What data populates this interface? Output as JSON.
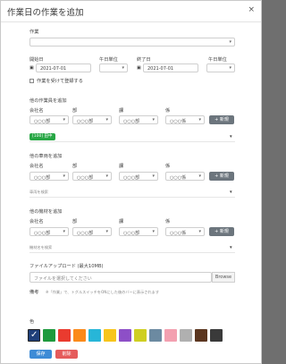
{
  "dialog": {
    "title": "作業日の作業を追加",
    "close": "×"
  },
  "task": {
    "label": "作業",
    "value": ""
  },
  "start": {
    "date_label": "開始日",
    "date_value": "2021-07-01",
    "half_label": "午日単位",
    "half_value": ""
  },
  "end": {
    "date_label": "終了日",
    "date_value": "2021-07-01",
    "half_label": "午日単位",
    "half_value": ""
  },
  "keep_unit": {
    "label": "作業を受けて登録する"
  },
  "section_workers": {
    "title": "他の作業員を追加",
    "cols": [
      "会社名",
      "部",
      "課",
      "係"
    ],
    "values": [
      "○○○部",
      "○○○部",
      "○○○部",
      "○○○係"
    ],
    "new_button": "+ 新規",
    "tag": "[100] 田中"
  },
  "section_vehicles": {
    "title": "他の車両を追加",
    "cols": [
      "会社名",
      "部",
      "課",
      "係"
    ],
    "values": [
      "○○○部",
      "○○○部",
      "○○○部",
      "○○○係"
    ],
    "new_button": "+ 新規",
    "hint": "車両を検索"
  },
  "section_machines": {
    "title": "他の機材を追加",
    "cols": [
      "会社名",
      "部",
      "課",
      "係"
    ],
    "values": [
      "○○○部",
      "○○○部",
      "○○○部",
      "○○○係"
    ],
    "new_button": "+ 新規",
    "hint": "機材名を検索"
  },
  "upload": {
    "label": "ファイルアップロード (最大10MB)",
    "placeholder": "ファイルを選択してください",
    "browse": "Browse"
  },
  "memo": {
    "label": "備考",
    "hint": "※「作業」で、トグルスイッチをONにした後のバーに表示されます"
  },
  "color": {
    "label": "色",
    "swatches": [
      "#1f3f7a",
      "#1e9a3d",
      "#ea3b2f",
      "#fb8a1a",
      "#27b6d8",
      "#f7c51b",
      "#8d4fc7",
      "#cfcf22",
      "#6c8aa1",
      "#f3a0b0",
      "#b0b0b0",
      "#5b3620",
      "#3a3a3a"
    ],
    "selected_index": 0
  },
  "actions": {
    "save": "保存",
    "delete": "削除",
    "save_color": "#3d8bd6",
    "delete_color": "#e55b5b"
  }
}
